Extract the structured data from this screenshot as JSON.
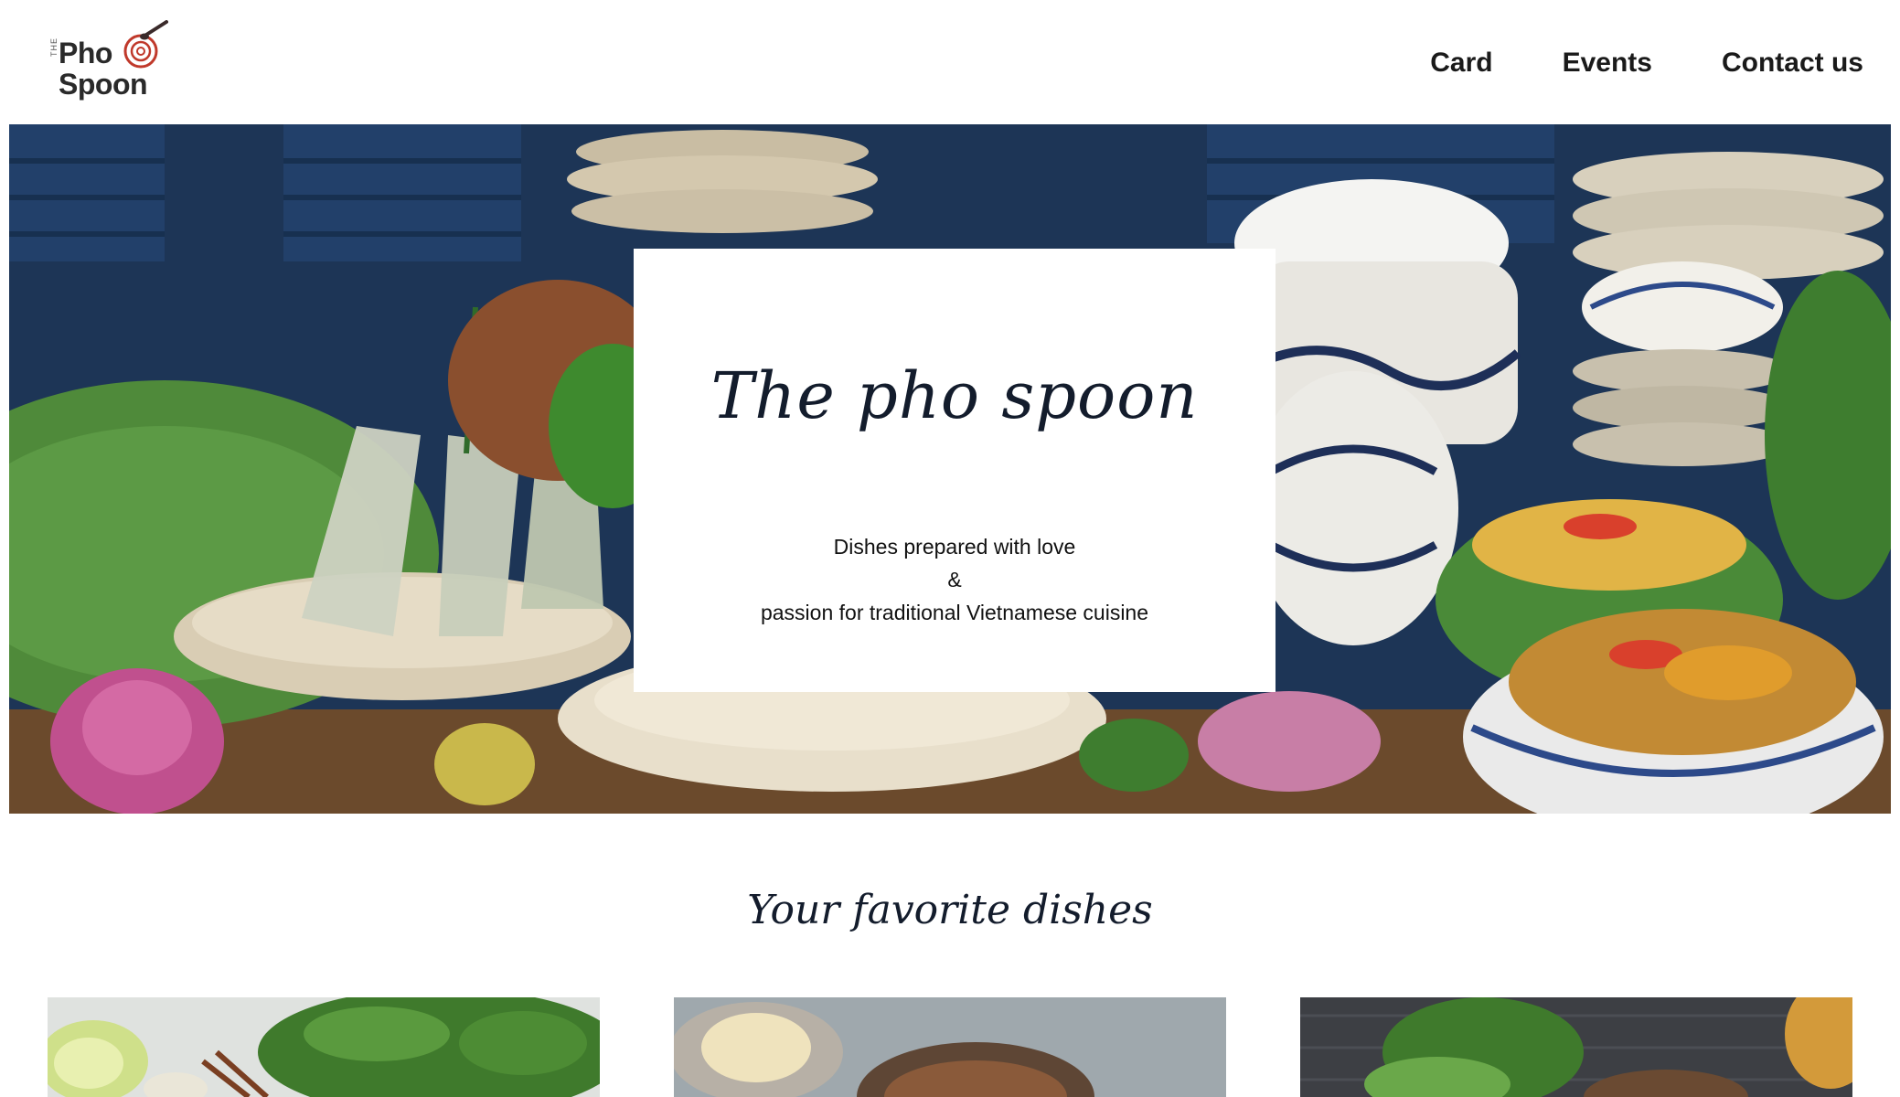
{
  "logo": {
    "prefix": "THE",
    "line1": "Pho",
    "line2": "Spoon"
  },
  "nav": {
    "items": [
      {
        "label": "Card"
      },
      {
        "label": "Events"
      },
      {
        "label": "Contact us"
      }
    ]
  },
  "hero": {
    "title": "The pho spoon",
    "subtitle_line1": "Dishes prepared with love",
    "subtitle_line2": "&",
    "subtitle_line3": "passion for traditional Vietnamese cuisine"
  },
  "favorites": {
    "title": "Your favorite dishes"
  },
  "colors": {
    "text_dark": "#131c2c",
    "logo_accent": "#c0392b",
    "hero_backdrop": "#1d3556",
    "leaf_green": "#4f8a3a"
  }
}
